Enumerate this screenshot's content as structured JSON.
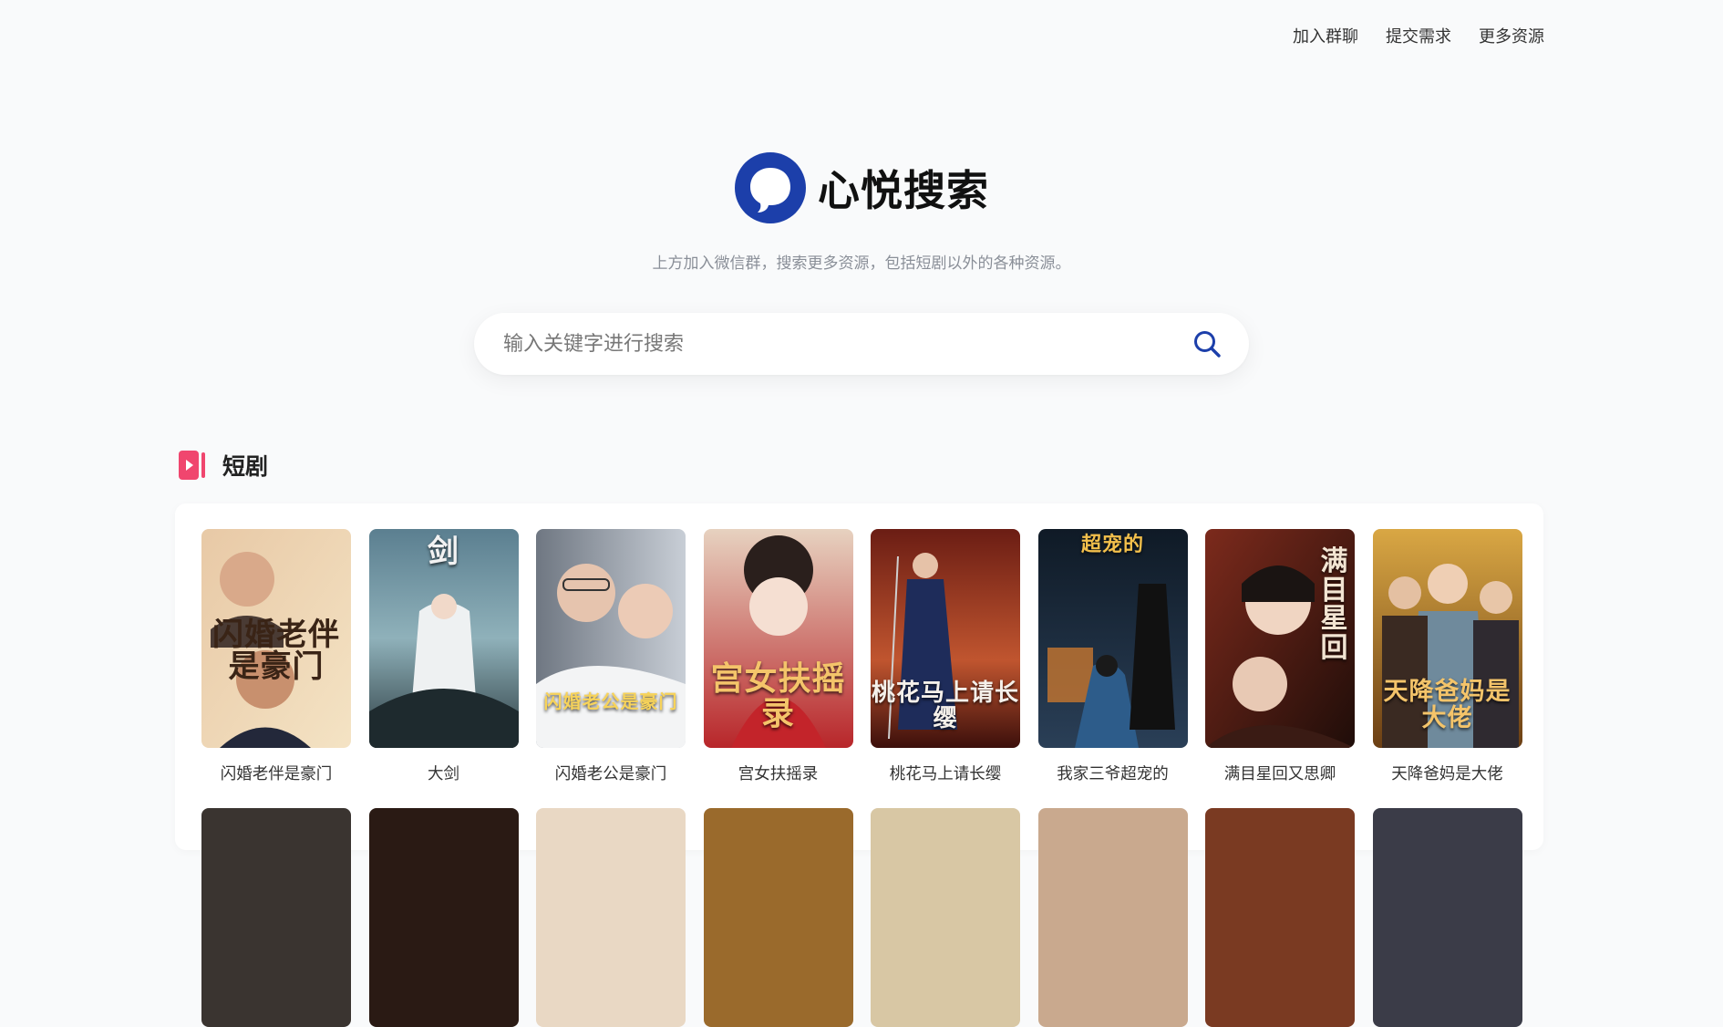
{
  "nav": {
    "items": [
      "加入群聊",
      "提交需求",
      "更多资源"
    ]
  },
  "brand": {
    "name": "心悦搜索",
    "color": "#1c3faa"
  },
  "tagline": "上方加入微信群，搜索更多资源，包括短剧以外的各种资源。",
  "search": {
    "placeholder": "输入关键字进行搜索",
    "icon": "search-icon"
  },
  "section": {
    "title": "短剧",
    "icon": "play-video-icon",
    "icon_color": "#f0466e"
  },
  "dramas": [
    {
      "title": "闪婚老伴是豪门",
      "poster_text": "闪婚老伴是豪门"
    },
    {
      "title": "大剑",
      "poster_text": "剑"
    },
    {
      "title": "闪婚老公是豪门",
      "poster_text": "闪婚老公是豪门"
    },
    {
      "title": "宫女扶摇录",
      "poster_text": "宫女扶摇录"
    },
    {
      "title": "桃花马上请长缨",
      "poster_text": "桃花马上请长缨"
    },
    {
      "title": "我家三爷超宠的",
      "poster_text": "超宠的"
    },
    {
      "title": "满目星回又思卿",
      "poster_text": "满目星回"
    },
    {
      "title": "天降爸妈是大佬",
      "poster_text": "天降爸妈是大佬"
    }
  ]
}
